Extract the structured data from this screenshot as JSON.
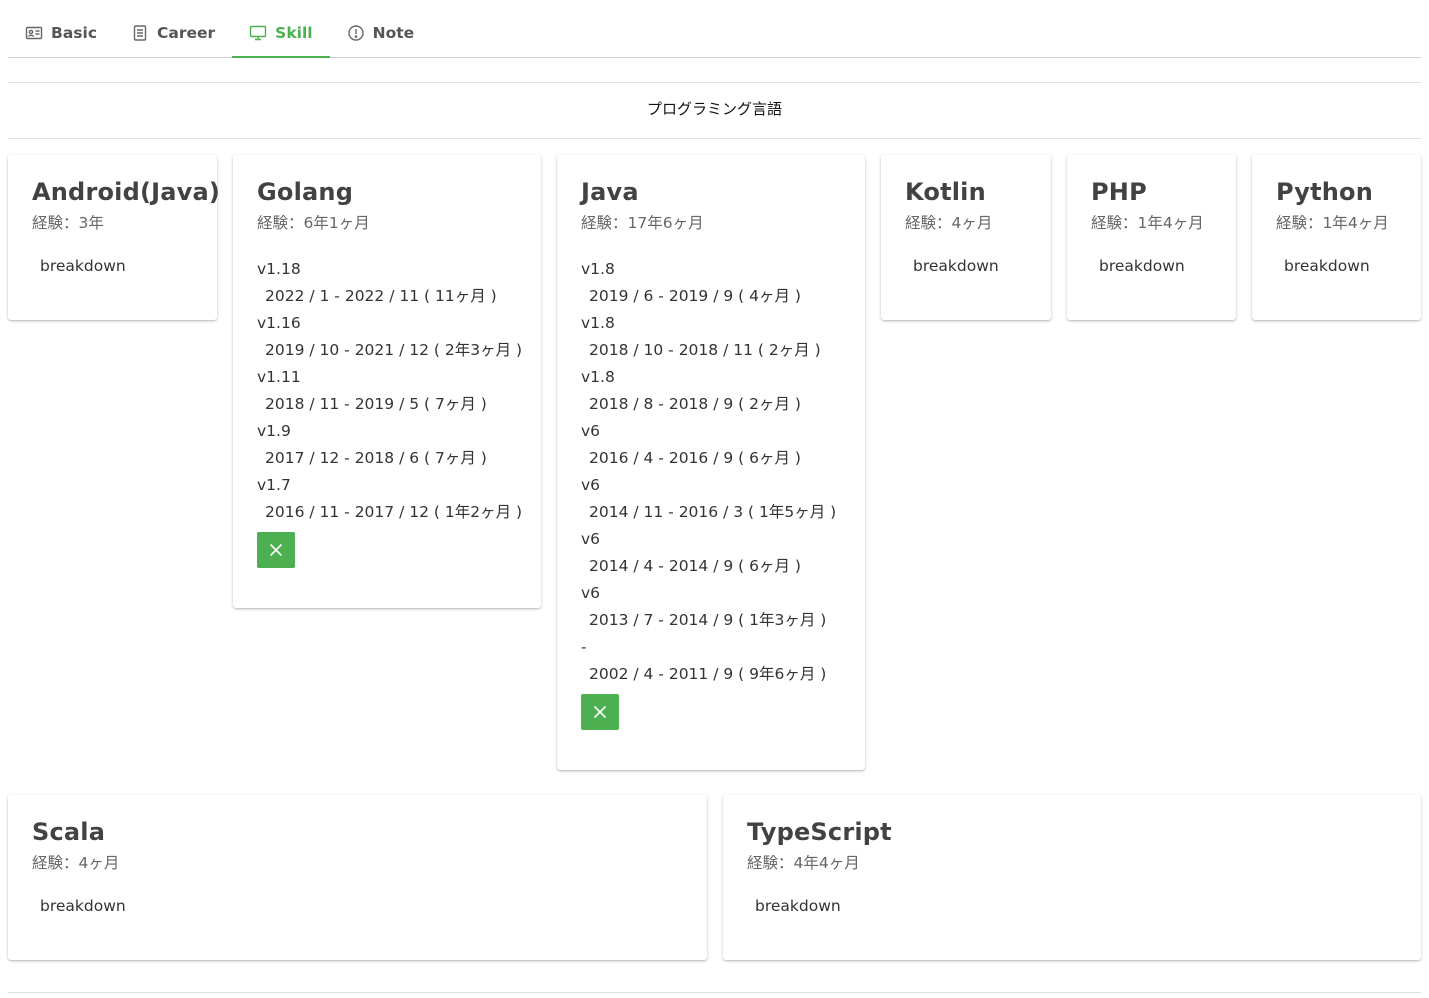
{
  "tabs": [
    {
      "label": "Basic",
      "icon": "id-card-icon"
    },
    {
      "label": "Career",
      "icon": "document-icon"
    },
    {
      "label": "Skill",
      "icon": "monitor-icon"
    },
    {
      "label": "Note",
      "icon": "info-circle-icon"
    }
  ],
  "active_tab": "Skill",
  "accent_color": "#4caf50",
  "section": {
    "title": "プログラミング言語"
  },
  "skills": [
    {
      "name": "Android(Java)",
      "experience": "経験：3年",
      "breakdown_label": "breakdown"
    },
    {
      "name": "Golang",
      "experience": "経験：6年1ヶ月",
      "entries": [
        {
          "version": "v1.18",
          "range": "2022 / 1 - 2022 / 11 ( 11ヶ月 )"
        },
        {
          "version": "v1.16",
          "range": "2019 / 10 - 2021 / 12 ( 2年3ヶ月 )"
        },
        {
          "version": "v1.11",
          "range": "2018 / 11 - 2019 / 5 ( 7ヶ月 )"
        },
        {
          "version": "v1.9",
          "range": "2017 / 12 - 2018 / 6 ( 7ヶ月 )"
        },
        {
          "version": "v1.7",
          "range": "2016 / 11 - 2017 / 12 ( 1年2ヶ月 )"
        }
      ]
    },
    {
      "name": "Java",
      "experience": "経験：17年6ヶ月",
      "entries": [
        {
          "version": "v1.8",
          "range": "2019 / 6 - 2019 / 9 ( 4ヶ月 )"
        },
        {
          "version": "v1.8",
          "range": "2018 / 10 - 2018 / 11 ( 2ヶ月 )"
        },
        {
          "version": "v1.8",
          "range": "2018 / 8 - 2018 / 9 ( 2ヶ月 )"
        },
        {
          "version": "v6",
          "range": "2016 / 4 - 2016 / 9 ( 6ヶ月 )"
        },
        {
          "version": "v6",
          "range": "2014 / 11 - 2016 / 3 ( 1年5ヶ月 )"
        },
        {
          "version": "v6",
          "range": "2014 / 4 - 2014 / 9 ( 6ヶ月 )"
        },
        {
          "version": "v6",
          "range": "2013 / 7 - 2014 / 9 ( 1年3ヶ月 )"
        },
        {
          "version": "-",
          "range": "2002 / 4 - 2011 / 9 ( 9年6ヶ月 )"
        }
      ]
    },
    {
      "name": "Kotlin",
      "experience": "経験：4ヶ月",
      "breakdown_label": "breakdown"
    },
    {
      "name": "PHP",
      "experience": "経験：1年4ヶ月",
      "breakdown_label": "breakdown"
    },
    {
      "name": "Python",
      "experience": "経験：1年4ヶ月",
      "breakdown_label": "breakdown"
    },
    {
      "name": "Scala",
      "experience": "経験：4ヶ月",
      "breakdown_label": "breakdown"
    },
    {
      "name": "TypeScript",
      "experience": "経験：4年4ヶ月",
      "breakdown_label": "breakdown"
    }
  ]
}
